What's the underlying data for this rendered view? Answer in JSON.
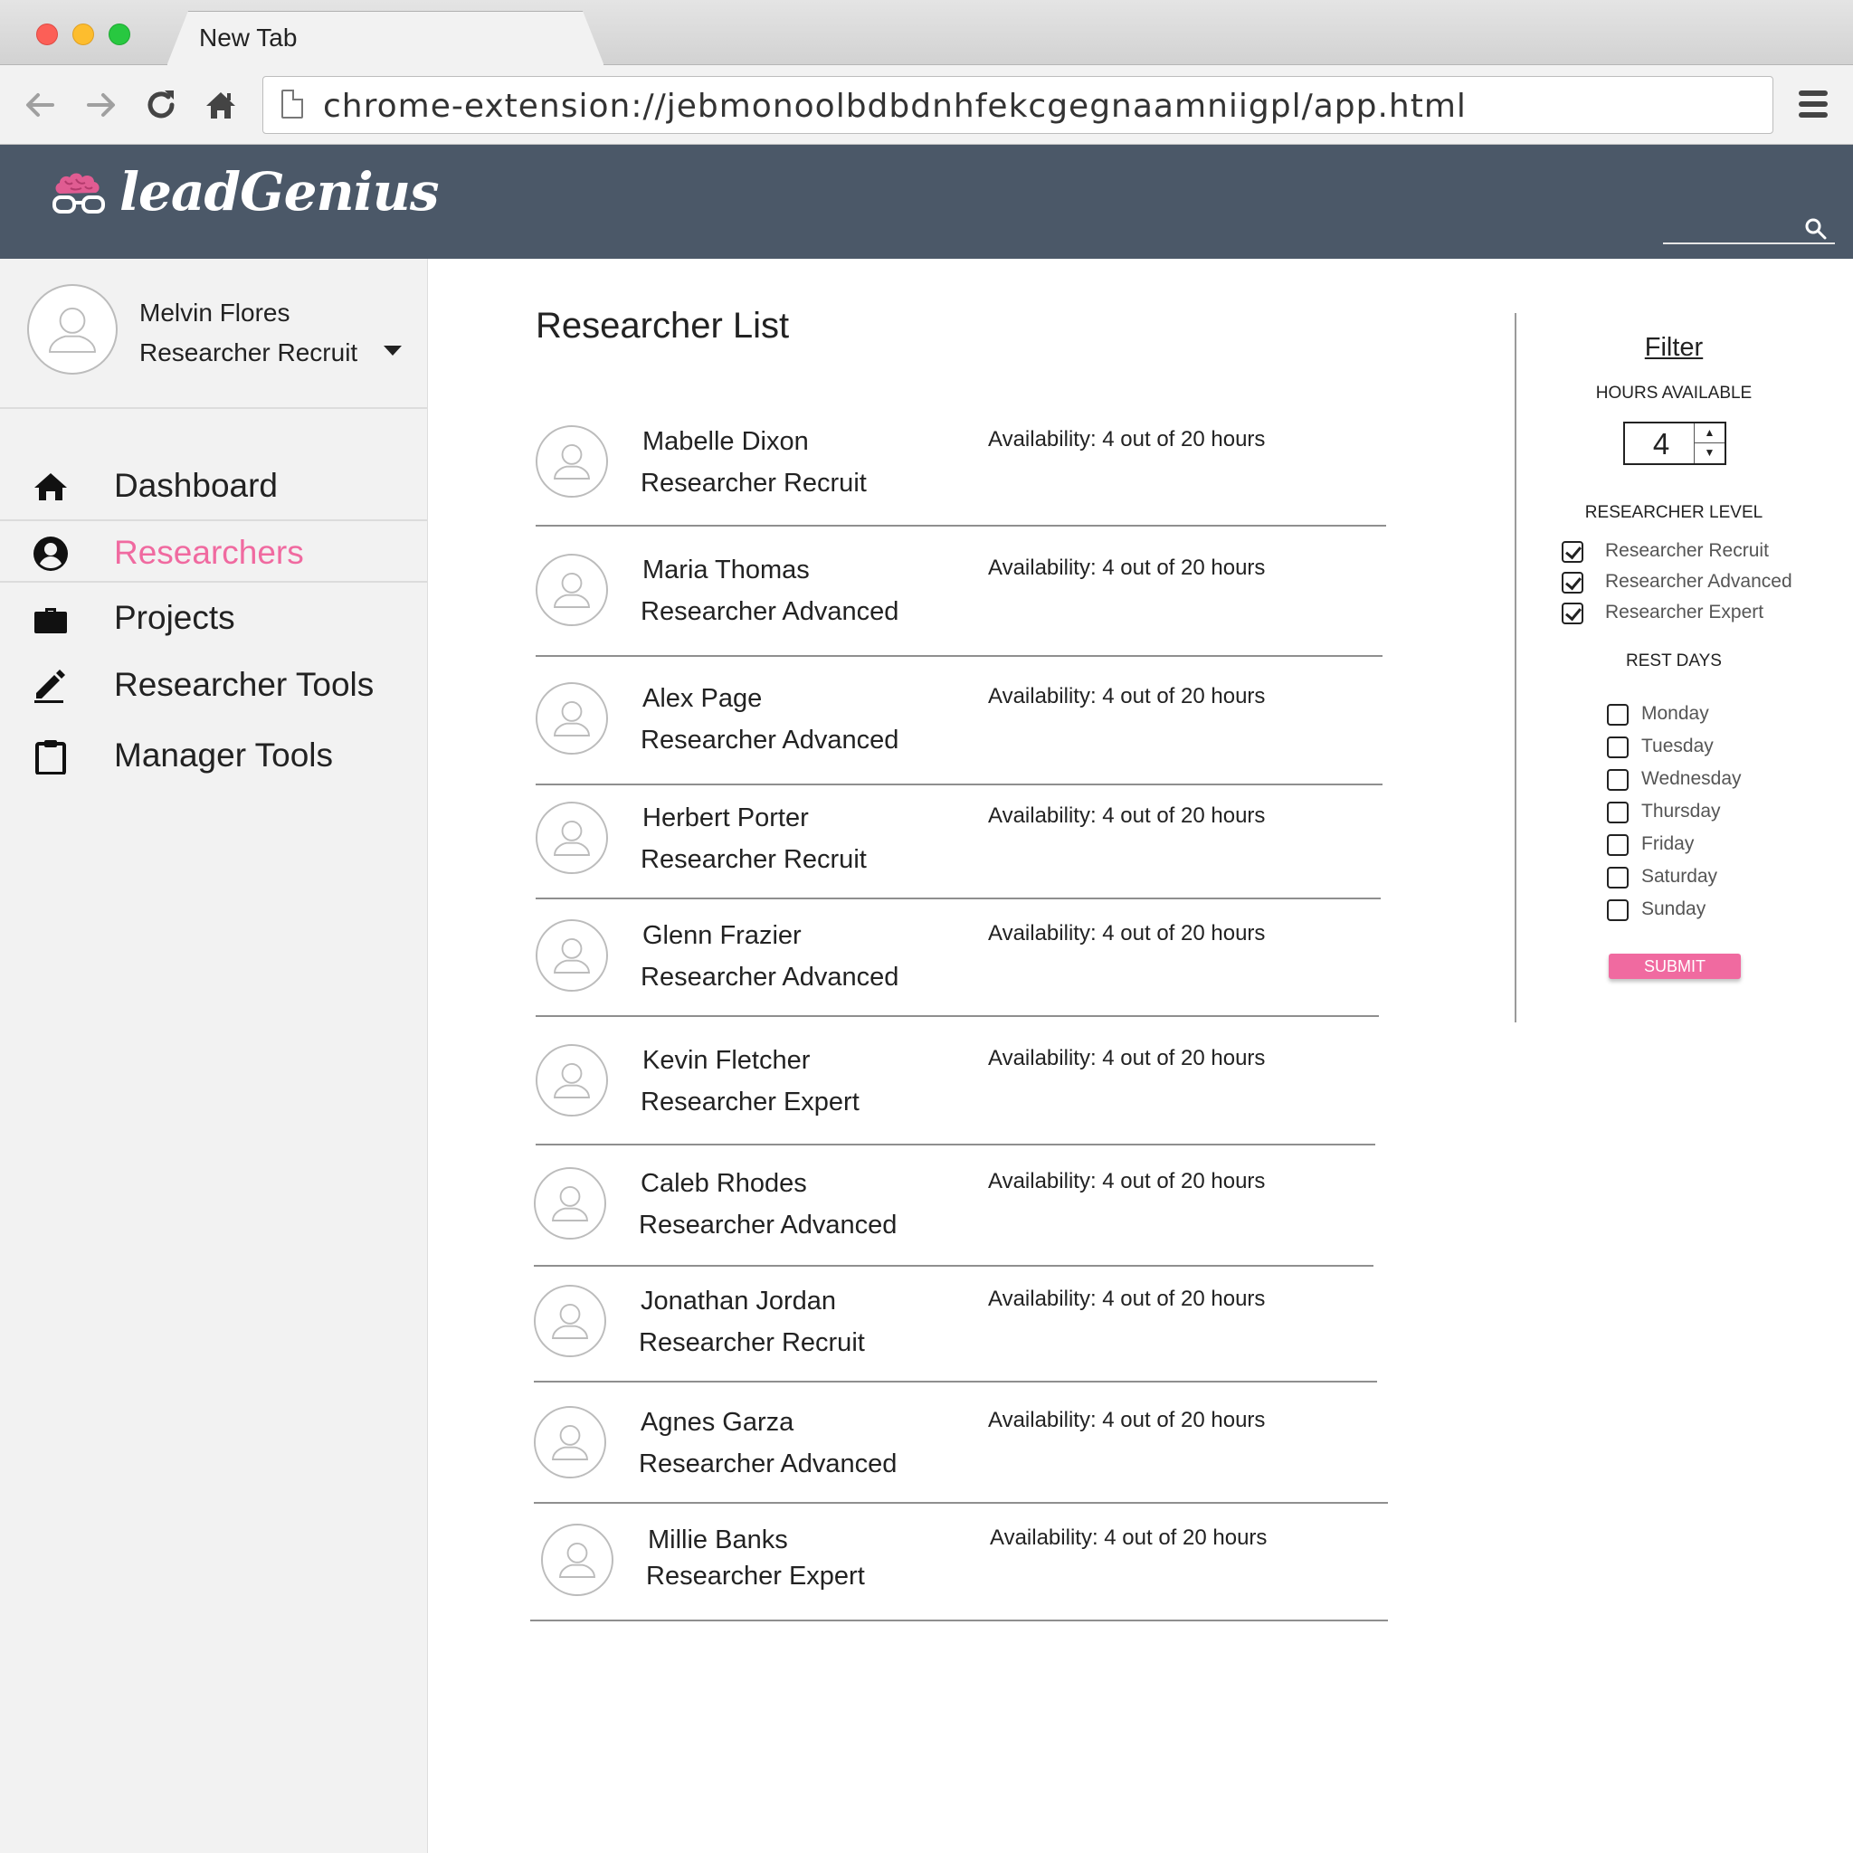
{
  "browser": {
    "tab_title": "New Tab",
    "url": "chrome-extension://jebmonoolbdbdnhfekcgegnaamniigpl/app.html"
  },
  "app": {
    "logo_text": "leadGenius",
    "brand_color": "#4b5868",
    "accent_color": "#f06aa0",
    "search_icon": "search-icon"
  },
  "profile": {
    "name": "Melvin Flores",
    "role": "Researcher Recruit"
  },
  "sidebar": {
    "items": [
      {
        "label": "Dashboard",
        "icon": "home-icon",
        "active": false
      },
      {
        "label": "Researchers",
        "icon": "user-circle-icon",
        "active": true
      },
      {
        "label": "Projects",
        "icon": "briefcase-icon",
        "active": false
      },
      {
        "label": "Researcher Tools",
        "icon": "pencil-icon",
        "active": false
      },
      {
        "label": "Manager Tools",
        "icon": "clipboard-icon",
        "active": false
      }
    ]
  },
  "main": {
    "title": "Researcher List",
    "researchers": [
      {
        "name": "Mabelle Dixon",
        "role": "Researcher Recruit",
        "availability": "Availability: 4 out of 20 hours"
      },
      {
        "name": "Maria Thomas",
        "role": "Researcher Advanced",
        "availability": "Availability: 4 out of 20 hours"
      },
      {
        "name": "Alex Page",
        "role": "Researcher Advanced",
        "availability": "Availability: 4 out of 20 hours"
      },
      {
        "name": "Herbert Porter",
        "role": "Researcher Recruit",
        "availability": "Availability: 4 out of 20 hours"
      },
      {
        "name": "Glenn Frazier",
        "role": "Researcher Advanced",
        "availability": "Availability: 4 out of 20 hours"
      },
      {
        "name": "Kevin Fletcher",
        "role": "Researcher Expert",
        "availability": "Availability: 4 out of 20 hours"
      },
      {
        "name": "Caleb Rhodes",
        "role": "Researcher Advanced",
        "availability": "Availability: 4 out of 20 hours"
      },
      {
        "name": "Jonathan Jordan",
        "role": "Researcher Recruit",
        "availability": "Availability: 4 out of 20 hours"
      },
      {
        "name": "Agnes Garza",
        "role": "Researcher Advanced",
        "availability": "Availability: 4 out of 20 hours"
      },
      {
        "name": "Millie Banks",
        "role": "Researcher Expert",
        "availability": "Availability: 4 out of 20 hours"
      }
    ]
  },
  "filter": {
    "title": "Filter",
    "hours_heading": "HOURS AVAILABLE",
    "hours_value": "4",
    "level_heading": "RESEARCHER LEVEL",
    "levels": [
      {
        "label": "Researcher Recruit",
        "checked": true
      },
      {
        "label": "Researcher Advanced",
        "checked": true
      },
      {
        "label": "Researcher Expert",
        "checked": true
      }
    ],
    "rest_heading": "REST DAYS",
    "days": [
      {
        "label": "Monday",
        "checked": false
      },
      {
        "label": "Tuesday",
        "checked": false
      },
      {
        "label": "Wednesday",
        "checked": false
      },
      {
        "label": "Thursday",
        "checked": false
      },
      {
        "label": "Friday",
        "checked": false
      },
      {
        "label": "Saturday",
        "checked": false
      },
      {
        "label": "Sunday",
        "checked": false
      }
    ],
    "submit_label": "SUBMIT"
  }
}
